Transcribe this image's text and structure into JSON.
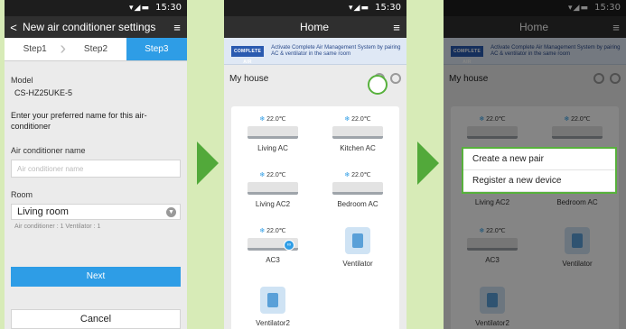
{
  "status_time": "15:30",
  "screen1": {
    "title": "New air conditioner settings",
    "steps": [
      "Step1",
      "Step2",
      "Step3"
    ],
    "model_label": "Model",
    "model_value": "CS-HZ25UKE-5",
    "instructions": "Enter your preferred name for this air-conditioner",
    "name_label": "Air conditioner name",
    "name_placeholder": "Air conditioner name",
    "room_label": "Room",
    "room_value": "Living room",
    "room_hint": "Air conditioner : 1    Ventilator : 1",
    "next_label": "Next",
    "cancel_label": "Cancel"
  },
  "screen2": {
    "title": "Home",
    "banner_logo": "COMPLETE AIR",
    "banner_text": "Activate Complete Air Management System by pairing AC & ventilator in the same room",
    "house_name": "My house",
    "devices": [
      {
        "name": "Living AC",
        "temp": "22.0℃"
      },
      {
        "name": "Kitchen AC",
        "temp": "22.0℃"
      },
      {
        "name": "Living AC2",
        "temp": "22.0℃"
      },
      {
        "name": "Bedroom AC",
        "temp": "22.0℃"
      },
      {
        "name": "AC3",
        "temp": "22.0℃"
      },
      {
        "name": "Ventilator",
        "temp": ""
      },
      {
        "name": "Ventilator2",
        "temp": ""
      }
    ]
  },
  "screen3": {
    "menu_items": [
      "Create a new pair",
      "Register a new device"
    ]
  },
  "icons": {
    "snow": "snowflake-icon",
    "menu": "menu-icon",
    "back": "back-arrow-icon",
    "pair": "pair-link-icon"
  },
  "colors": {
    "accent": "#2e9de6",
    "highlight": "#57b13c",
    "arrow": "#52a93a",
    "background": "#d7ebb7"
  }
}
